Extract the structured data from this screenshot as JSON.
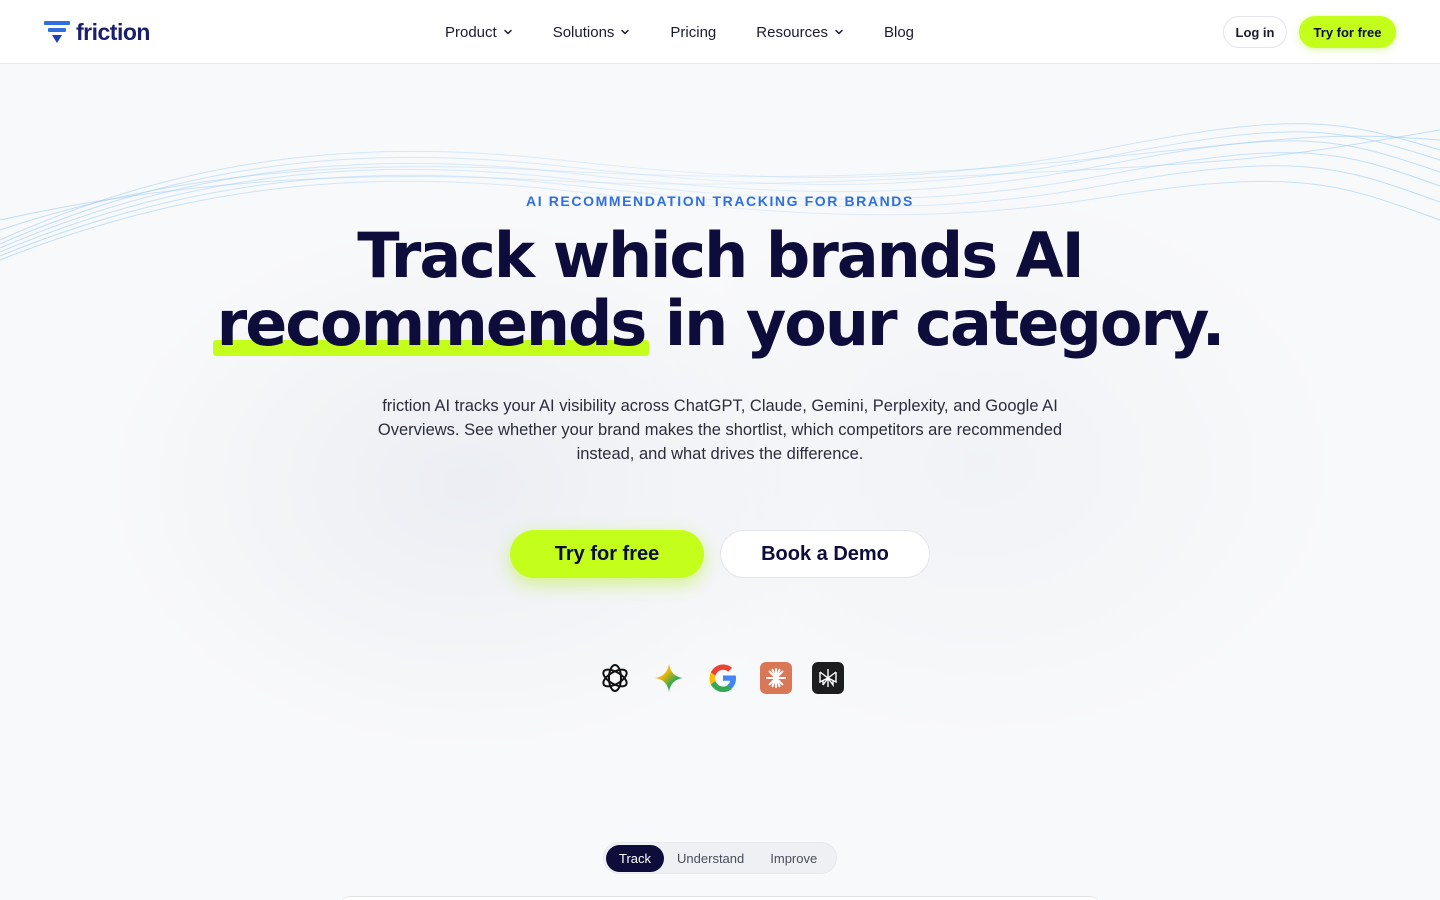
{
  "brand": {
    "name": "friction",
    "logo_icon": "friction-logo-icon",
    "accent": "#c3ff1a",
    "navy": "#0d0c3a",
    "blue": "#2f6fe0"
  },
  "nav": {
    "items": [
      {
        "label": "Product",
        "has_dropdown": true
      },
      {
        "label": "Solutions",
        "has_dropdown": true
      },
      {
        "label": "Pricing",
        "has_dropdown": false
      },
      {
        "label": "Resources",
        "has_dropdown": true
      },
      {
        "label": "Blog",
        "has_dropdown": false
      }
    ],
    "login_label": "Log in",
    "try_label": "Try for free"
  },
  "hero": {
    "eyebrow": "AI RECOMMENDATION TRACKING FOR BRANDS",
    "headline_line1": "Track which brands AI",
    "headline_highlight": "recommends",
    "headline_rest": " in your category.",
    "subtitle": "friction AI tracks your AI visibility across ChatGPT, Claude, Gemini, Perplexity, and Google AI Overviews. See whether your brand makes the shortlist, which competitors are recommended instead, and what drives the difference.",
    "primary_cta": "Try for free",
    "secondary_cta": "Book a Demo"
  },
  "ai_logos": [
    "openai-icon",
    "gemini-icon",
    "google-icon",
    "claude-icon",
    "perplexity-icon"
  ],
  "tabs": {
    "items": [
      "Track",
      "Understand",
      "Improve"
    ],
    "active": "Track"
  }
}
